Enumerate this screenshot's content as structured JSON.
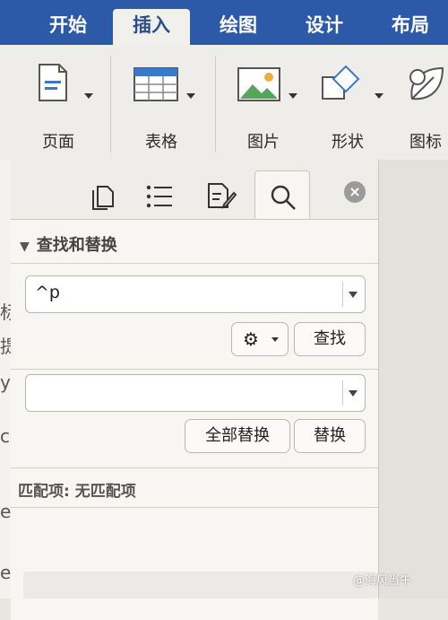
{
  "ribbon_tabs": [
    "开始",
    "插入",
    "绘图",
    "设计",
    "布局"
  ],
  "ribbon_groups": {
    "page": "页面",
    "table": "表格",
    "picture": "图片",
    "shapes": "形状",
    "icons": "图标"
  },
  "doc_strip_chars": [
    "标",
    "提",
    "y",
    "c",
    "e",
    "e"
  ],
  "pane": {
    "section_title": "查找和替换",
    "find_value": "^p",
    "find_button": "查找",
    "replace_value": "",
    "replace_all_button": "全部替换",
    "replace_button": "替换",
    "match_status": "匹配项: 无匹配项"
  },
  "watermark": "@海风当午",
  "colors": {
    "tab_bar": "#2d5aa8",
    "active_tab_text": "#2a4f8f"
  }
}
